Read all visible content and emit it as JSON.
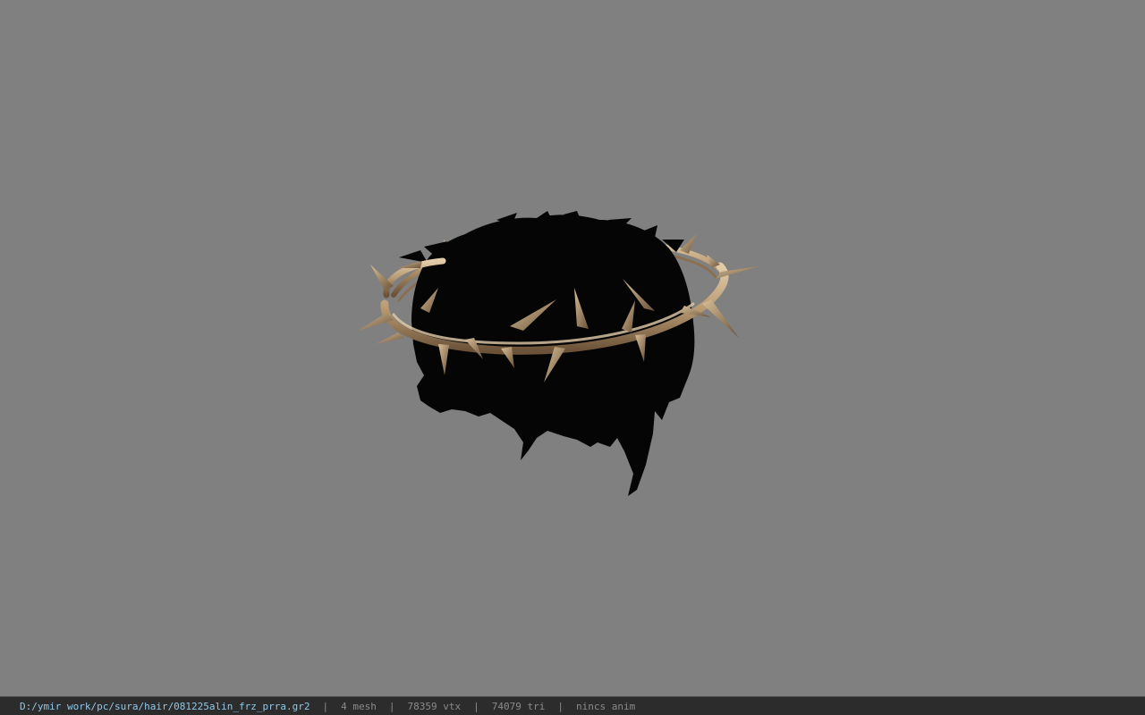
{
  "viewport": {
    "background_color": "#808080",
    "model": {
      "hair_color": "#050505",
      "crown_color": "#b89a72",
      "crown_highlight": "#e2ccaa",
      "crown_shadow": "#6b5238"
    }
  },
  "status_bar": {
    "file_path": "D:/ymir work/pc/sura/hair/081225alin_frz_prra.gr2",
    "separator": "|",
    "mesh_count": "4 mesh",
    "vertex_count": "78359 vtx",
    "triangle_count": "74079 tri",
    "animation": "nincs anim",
    "path_color": "#8fc8e8",
    "text_color": "#8a8a8a",
    "background_color": "#2c2c2c"
  }
}
